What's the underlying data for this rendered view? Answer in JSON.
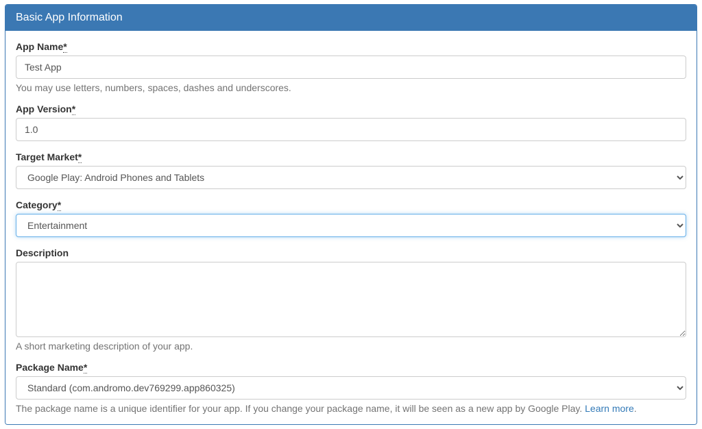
{
  "panel": {
    "title": "Basic App Information"
  },
  "fields": {
    "appName": {
      "label": "App Name",
      "required": "*",
      "value": "Test App",
      "help": "You may use letters, numbers, spaces, dashes and underscores."
    },
    "appVersion": {
      "label": "App Version",
      "required": "*",
      "value": "1.0"
    },
    "targetMarket": {
      "label": "Target Market",
      "required": "*",
      "selected": "Google Play: Android Phones and Tablets"
    },
    "category": {
      "label": "Category",
      "required": "*",
      "selected": "Entertainment"
    },
    "description": {
      "label": "Description",
      "value": "",
      "help": "A short marketing description of your app."
    },
    "packageName": {
      "label": "Package Name",
      "required": "*",
      "selected": "Standard (com.andromo.dev769299.app860325)",
      "help": "The package name is a unique identifier for your app. If you change your package name, it will be seen as a new app by Google Play. ",
      "learnMore": "Learn more"
    }
  }
}
